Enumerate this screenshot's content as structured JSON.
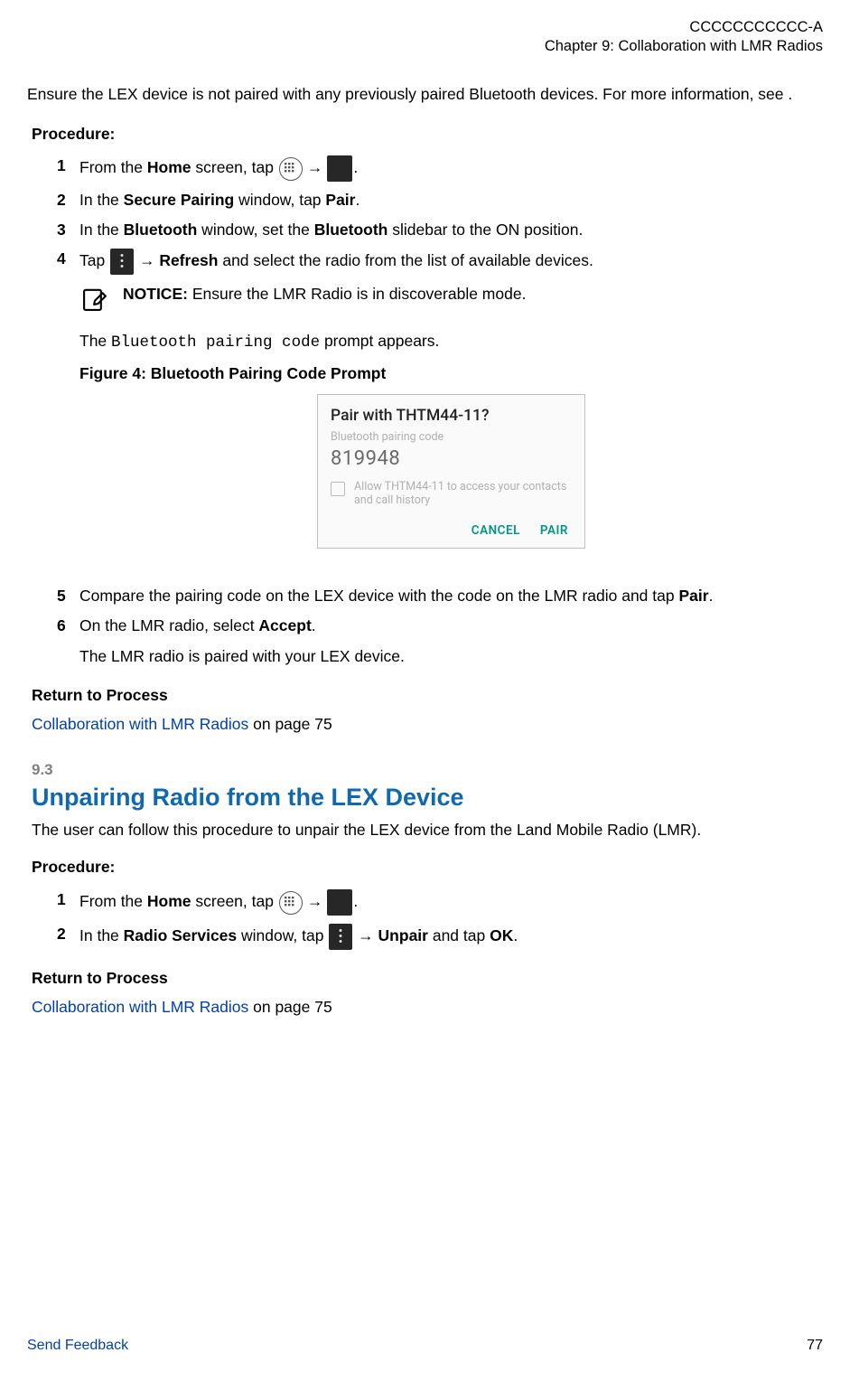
{
  "header": {
    "doc_id": "CCCCCCCCCCC-A",
    "chapter_line": "Chapter 9:  Collaboration with LMR Radios"
  },
  "intro": "Ensure the LEX device is not paired with any previously paired Bluetooth devices. For more information, see .",
  "procedure_label": "Procedure:",
  "pairing": {
    "steps": {
      "s1": {
        "num": "1",
        "pre": "From the ",
        "home": "Home",
        "post": " screen, tap "
      },
      "s2": {
        "num": "2",
        "t1": "In the ",
        "secure": "Secure Pairing",
        "t2": " window, tap ",
        "pair": "Pair",
        "period": "."
      },
      "s3": {
        "num": "3",
        "t1": "In the ",
        "bt1": "Bluetooth",
        "t2": " window, set the ",
        "bt2": "Bluetooth",
        "t3": " slidebar to the ON position."
      },
      "s4": {
        "num": "4",
        "line1a": "Tap ",
        "arrow": " → ",
        "refresh": "Refresh",
        "line1b": " and select the radio from the list of available devices.",
        "notice_label": "NOTICE:",
        "notice_text": " Ensure the LMR Radio is in discoverable mode.",
        "line2a": "The ",
        "code": "Bluetooth pairing code",
        "line2b": " prompt appears.",
        "fig_caption": "Figure 4: Bluetooth Pairing Code Prompt"
      },
      "s5": {
        "num": "5",
        "t1": "Compare the pairing code on the LEX device with the code on the LMR radio and tap ",
        "pair": "Pair",
        "period": "."
      },
      "s6": {
        "num": "6",
        "t1": "On the LMR radio, select ",
        "accept": "Accept",
        "period": ".",
        "result": "The LMR radio is paired with your LEX device."
      }
    }
  },
  "dialog": {
    "title": "Pair with THTM44-11?",
    "sub": "Bluetooth pairing code",
    "code": "819948",
    "check_label": "Allow THTM44-11 to access your contacts and call history",
    "cancel": "CANCEL",
    "pair": "PAIR"
  },
  "return_label": "Return to Process",
  "return_link_text": "Collaboration with LMR Radios",
  "return_link_tail": " on page 75",
  "section_9_3": {
    "num": "9.3",
    "title": "Unpairing Radio from the LEX Device",
    "intro": "The user can follow this procedure to unpair the LEX device from the Land Mobile Radio (LMR).",
    "steps": {
      "s1": {
        "num": "1",
        "pre": "From the ",
        "home": "Home",
        "post": " screen, tap "
      },
      "s2": {
        "num": "2",
        "t1": "In the ",
        "rs": "Radio Services",
        "t2": " window, tap ",
        "arrow": " → ",
        "unpair": "Unpair",
        "t3": " and tap ",
        "ok": "OK",
        "period": "."
      }
    }
  },
  "footer": {
    "left": "Send Feedback",
    "right": "77"
  }
}
